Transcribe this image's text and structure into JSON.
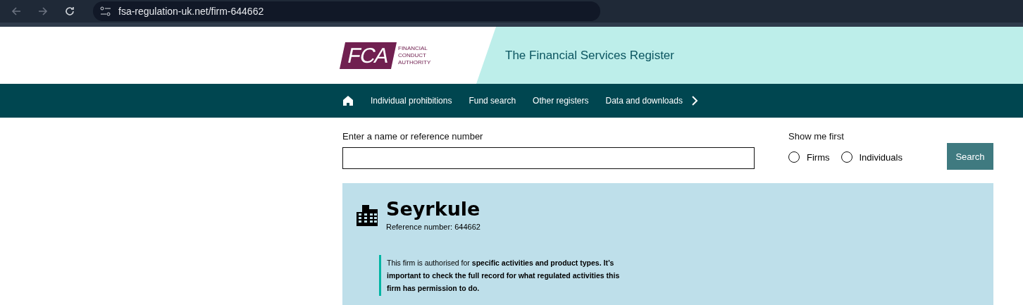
{
  "browser": {
    "url": "fsa-regulation-uk.net/firm-644662"
  },
  "header": {
    "logo_mark": "FCA",
    "logo_lines": [
      "FINANCIAL",
      "CONDUCT",
      "AUTHORITY"
    ],
    "title": "The Financial Services Register"
  },
  "nav": {
    "items": [
      "Individual prohibitions",
      "Fund search",
      "Other registers",
      "Data and downloads"
    ]
  },
  "search": {
    "label": "Enter a name or reference number",
    "show_first_label": "Show me first",
    "options": [
      {
        "label": "Firms",
        "selected": false
      },
      {
        "label": "Individuals",
        "selected": false
      }
    ],
    "button": "Search"
  },
  "firm": {
    "name": "Seyrkule",
    "reference": "Reference number: 644662",
    "notice": "This firm is authorised for **specific activities and product types. It’s important to check the full record for what regulated activities this firm has permission to do.**"
  }
}
